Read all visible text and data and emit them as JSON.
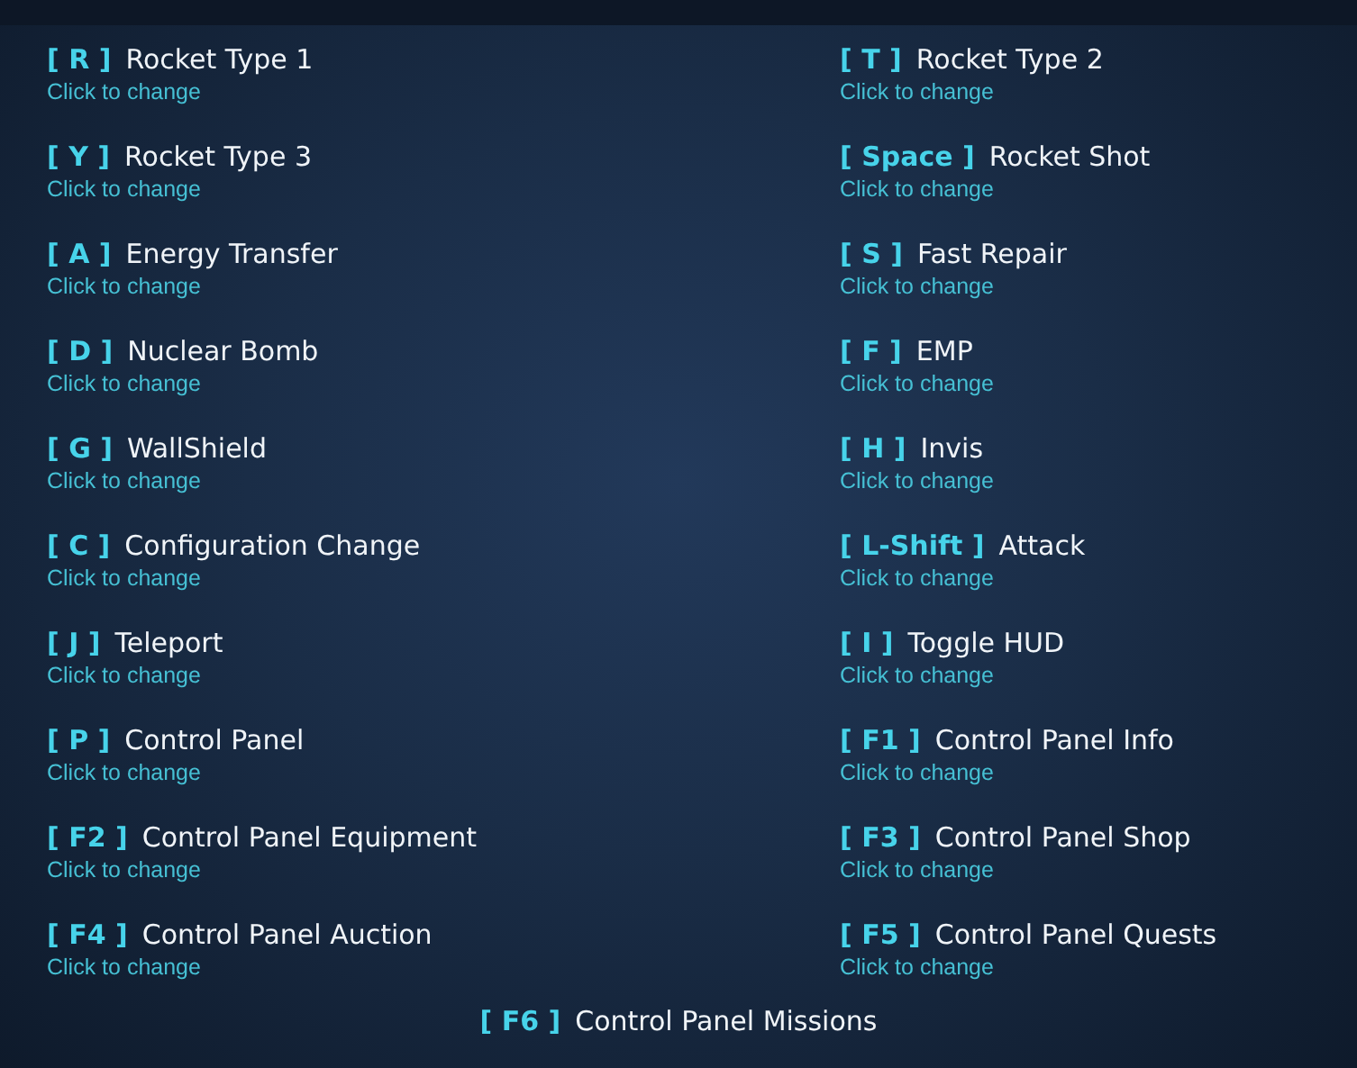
{
  "bindings": [
    {
      "key": "[ R ]",
      "action": "Rocket Type 1",
      "hint": "Click to change"
    },
    {
      "key": "[ T ]",
      "action": "Rocket Type 2",
      "hint": "Click to change"
    },
    {
      "key": "[ Y ]",
      "action": "Rocket Type 3",
      "hint": "Click to change"
    },
    {
      "key": "[ Space ]",
      "action": "Rocket Shot",
      "hint": "Click to change"
    },
    {
      "key": "[ A ]",
      "action": "Energy Transfer",
      "hint": "Click to change"
    },
    {
      "key": "[ S ]",
      "action": "Fast Repair",
      "hint": "Click to change"
    },
    {
      "key": "[ D ]",
      "action": "Nuclear Bomb",
      "hint": "Click to change"
    },
    {
      "key": "[ F ]",
      "action": "EMP",
      "hint": "Click to change"
    },
    {
      "key": "[ G ]",
      "action": "WallShield",
      "hint": "Click to change"
    },
    {
      "key": "[ H ]",
      "action": "Invis",
      "hint": "Click to change"
    },
    {
      "key": "[ C ]",
      "action": "Configuration Change",
      "hint": "Click to change"
    },
    {
      "key": "[ L-Shift ]",
      "action": "Attack",
      "hint": "Click to change"
    },
    {
      "key": "[ J ]",
      "action": "Teleport",
      "hint": "Click to change"
    },
    {
      "key": "[ I ]",
      "action": "Toggle HUD",
      "hint": "Click to change"
    },
    {
      "key": "[ P ]",
      "action": "Control Panel",
      "hint": "Click to change"
    },
    {
      "key": "[ F1 ]",
      "action": "Control Panel Info",
      "hint": "Click to change"
    },
    {
      "key": "[ F2 ]",
      "action": "Control Panel Equipment",
      "hint": "Click to change"
    },
    {
      "key": "[ F3 ]",
      "action": "Control Panel Shop",
      "hint": "Click to change"
    },
    {
      "key": "[ F4 ]",
      "action": "Control Panel Auction",
      "hint": "Click to change"
    },
    {
      "key": "[ F5 ]",
      "action": "Control Panel Quests",
      "hint": "Click to change"
    }
  ],
  "footer": {
    "key": "[ F6 ]",
    "action": "Control Panel Missions"
  }
}
